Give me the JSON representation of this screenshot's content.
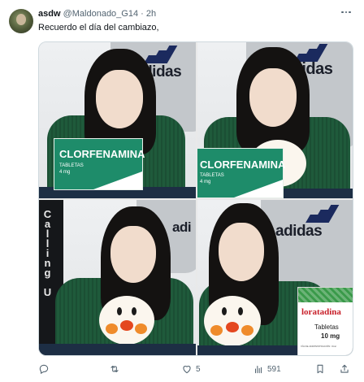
{
  "tweet": {
    "display_name": "asdw",
    "handle": "@Maldonado_G14",
    "separator": "·",
    "time": "2h",
    "text": "Recuerdo el día del cambiazo,"
  },
  "media": {
    "panels": [
      {
        "hoodie_brand": "adidas",
        "box_title": "CLORFENAMINA",
        "box_sub1": "TABLETAS",
        "box_sub2": "4 mg"
      },
      {
        "hoodie_brand": "adidas",
        "box_title": "CLORFENAMINA",
        "box_sub1": "TABLETAS",
        "box_sub2": "4 mg"
      },
      {
        "hoodie_brand": "adi",
        "side_text": "Calling U"
      },
      {
        "hoodie_brand": "adidas",
        "box_title": "loratadina",
        "box_sub1": "Tabletas",
        "box_sub2": "10 mg",
        "box_fine": "VÍA DE ADMINISTRACIÓN: Oral"
      }
    ]
  },
  "actions": {
    "reply_count": "",
    "retweet_count": "",
    "like_count": "5",
    "views_count": "591"
  },
  "colors": {
    "accent": "#1d9bf0",
    "muted_text": "#536471",
    "box_green": "#1e8c6a",
    "loratadina_red": "#c8202a"
  }
}
